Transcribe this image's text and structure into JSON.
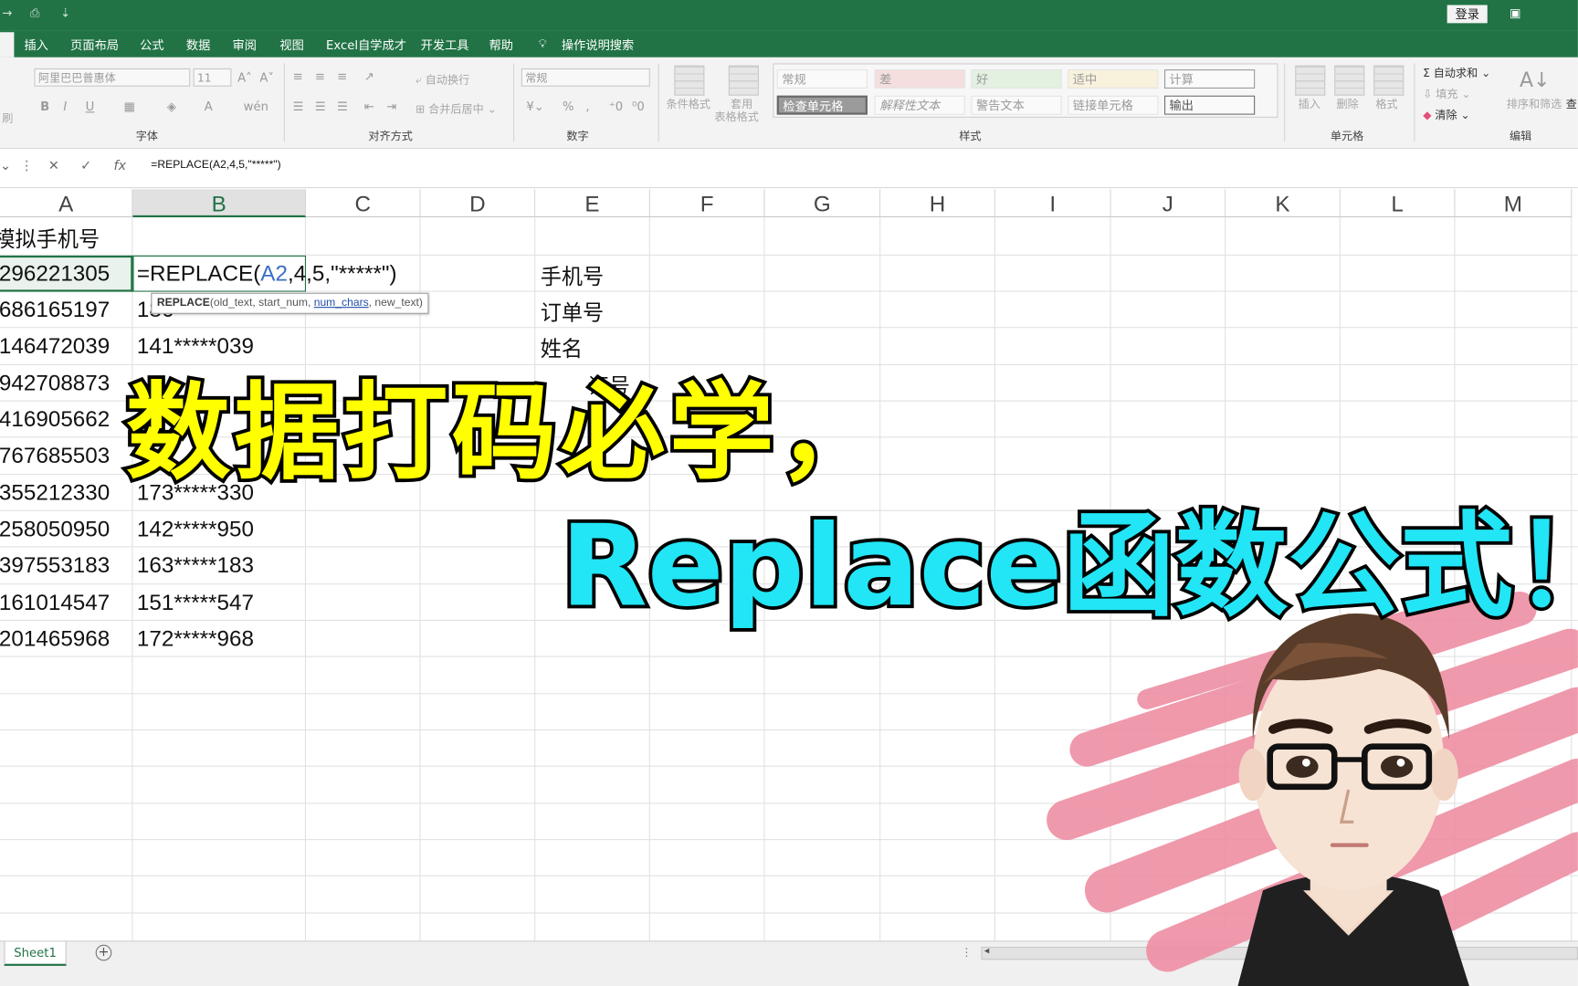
{
  "titlebar": {
    "login": "登录",
    "qa_customize": "⇣"
  },
  "tabs": [
    "插入",
    "页面布局",
    "公式",
    "数据",
    "审阅",
    "视图",
    "Excel自学成才",
    "开发工具",
    "帮助",
    "操作说明搜索"
  ],
  "ribbon": {
    "font_group": "字体",
    "align_group": "对齐方式",
    "number_group": "数字",
    "styles_group": "样式",
    "cells_group": "单元格",
    "edit_group": "编辑",
    "font_name": "阿里巴巴普惠体",
    "font_size": "11",
    "wrap_text": "自动换行",
    "merge_center": "合并后居中",
    "number_format": "常规",
    "cond_format": "条件格式",
    "table_format_1": "套用",
    "table_format_2": "表格格式",
    "styles": [
      "常规",
      "差",
      "好",
      "适中",
      "计算",
      "检查单元格",
      "解释性文本",
      "警告文本",
      "链接单元格",
      "输出"
    ],
    "insert": "插入",
    "delete": "删除",
    "format": "格式",
    "autosum": "自动求和",
    "fill": "填充",
    "clear": "清除",
    "sort_filter": "排序和筛选",
    "find_select": "查"
  },
  "formula_bar": {
    "cancel": "✕",
    "enter": "✓",
    "fx": "fx",
    "formula": "=REPLACE(A2,4,5,\"*****\")"
  },
  "columns": [
    "A",
    "B",
    "C",
    "D",
    "E",
    "F",
    "G",
    "H",
    "I",
    "J",
    "K",
    "L",
    "M"
  ],
  "cells": {
    "A1": "模拟手机号",
    "A": [
      "296221305",
      "686165197",
      "146472039",
      "942708873",
      "416905662",
      "767685503",
      "355212330",
      "258050950",
      "397553183",
      "161014547",
      "201465968"
    ],
    "B_edit_pre": "=REPLACE(",
    "B_edit_ref": "A2",
    "B_edit_post": ",4,5,\"*****\")",
    "B3_partial": "186",
    "B": [
      "",
      "",
      "141*****039",
      "",
      "",
      "",
      "173*****330",
      "142*****950",
      "163*****183",
      "151*****547",
      "172*****968"
    ],
    "E": [
      "手机号",
      "订单号",
      "姓名",
      "证号"
    ]
  },
  "tooltip": {
    "fn": "REPLACE",
    "a1": "(old_text, start_num, ",
    "a2": "num_chars",
    "a3": ", new_text)"
  },
  "sheet": {
    "tab": "Sheet1",
    "add": "+"
  },
  "overlay": {
    "line1": "数据打码必学，",
    "line2": "Replace函数公式！"
  },
  "colors": {
    "excel_green": "#217346",
    "title_yellow": "#ffff00",
    "title_cyan": "#22e5f5",
    "brush_pink": "#ee8ea3"
  }
}
